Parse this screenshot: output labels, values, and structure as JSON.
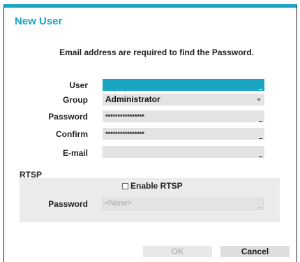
{
  "dialog": {
    "title": "New User",
    "notice": "Email address are required to find the Password."
  },
  "form": {
    "user": {
      "label": "User",
      "value": ""
    },
    "group": {
      "label": "Group",
      "value": "Administrator"
    },
    "password": {
      "label": "Password",
      "value": "****************"
    },
    "confirm": {
      "label": "Confirm",
      "value": "****************"
    },
    "email": {
      "label": "E-mail",
      "value": ""
    }
  },
  "rtsp": {
    "section_label": "RTSP",
    "enable_label": "Enable RTSP",
    "enable_checked": false,
    "password_label": "Password",
    "password_value": "<None>"
  },
  "buttons": {
    "ok_label": "OK",
    "cancel_label": "Cancel"
  },
  "colors": {
    "accent": "#1aa5c1",
    "field_bg": "#e3e3e3",
    "panel_bg": "#ebebeb"
  }
}
